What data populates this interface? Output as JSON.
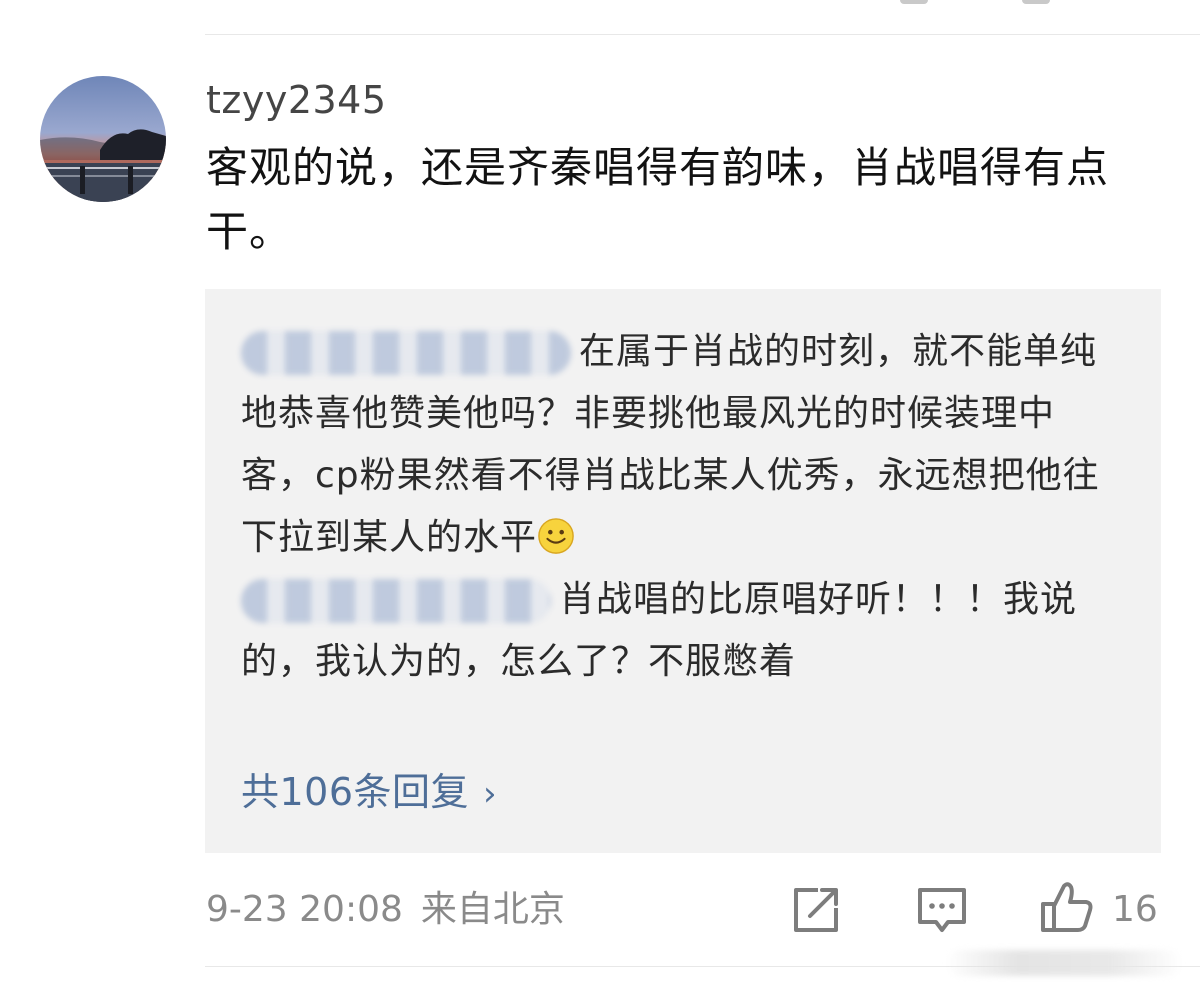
{
  "comment": {
    "username": "tzyy2345",
    "text": "客观的说，还是齐秦唱得有韵味，肖战唱得有点干。",
    "avatar_icon": "sunset-landscape-avatar"
  },
  "replies": [
    {
      "text": "在属于肖战的时刻，就不能单纯地恭喜他赞美他吗？非要挑他最风光的时候装理中客，cp粉果然看不得肖战比某人优秀，永远想把他往下拉到某人的水平",
      "trailing_icon": "smile-emoji-icon"
    },
    {
      "text": "肖战唱的比原唱好听！！！我说的，我认为的，怎么了？不服憋着"
    }
  ],
  "more_replies": {
    "label": "共106条回复",
    "chevron": "›"
  },
  "meta": {
    "time": "9-23 20:08",
    "location": "来自北京"
  },
  "actions": {
    "like_count": "16",
    "icons": [
      "share-icon",
      "comment-icon",
      "thumbs-up-icon"
    ]
  },
  "colors": {
    "link": "#4e6e98",
    "reply_background": "#f2f2f2",
    "meta_text": "#8a8a8a"
  }
}
